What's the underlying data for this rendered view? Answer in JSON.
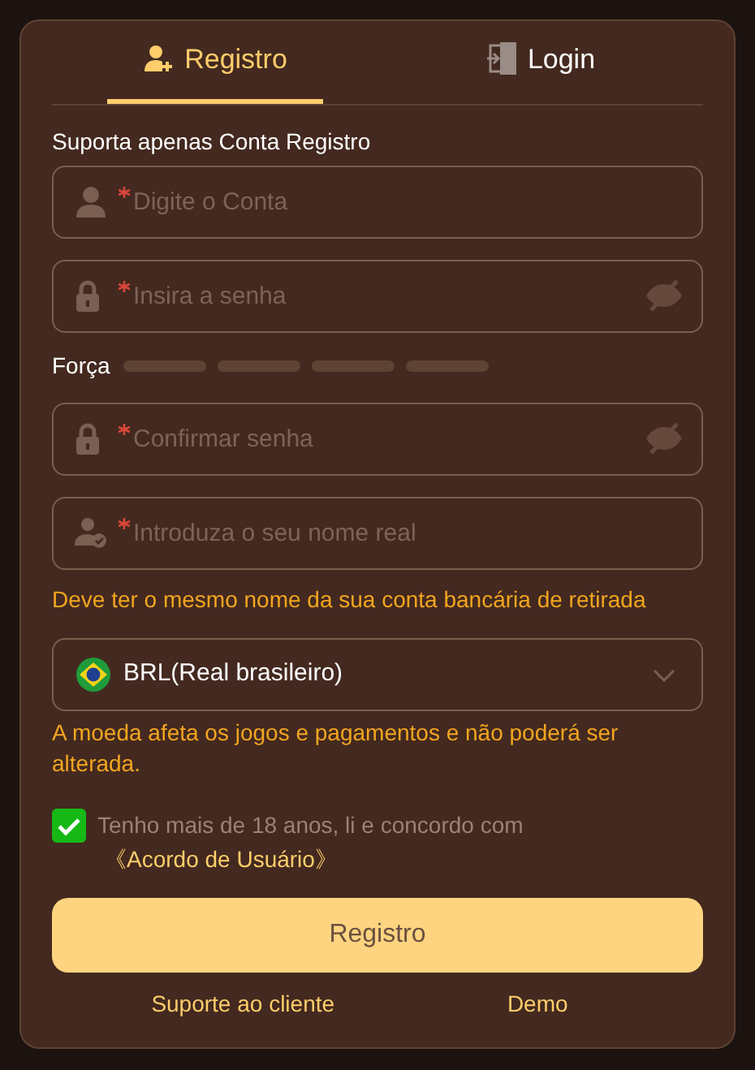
{
  "tabs": [
    {
      "label": "Registro",
      "selected": true
    },
    {
      "label": "Login",
      "selected": false
    }
  ],
  "notice": "Suporta apenas Conta Registro",
  "form": [
    {
      "kind": "account",
      "placeholder": "Digite o Conta"
    },
    {
      "kind": "password",
      "placeholder": "Insira a senha"
    },
    {
      "kind": "strength",
      "label": "Força"
    },
    {
      "kind": "password",
      "placeholder": "Confirmar senha"
    },
    {
      "kind": "name",
      "placeholder": "Introduza o seu nome real"
    },
    {
      "kind": "hint",
      "text": "Deve ter o mesmo nome da sua conta bancária de retirada"
    },
    {
      "kind": "select",
      "value": "BRL(Real brasileiro)"
    },
    {
      "kind": "hint",
      "text": "A moeda afeta os jogos e pagamentos e não poderá ser alterada."
    }
  ],
  "agreement": {
    "checked": true,
    "text": "Tenho mais de 18 anos, li e concordo com",
    "link": "《Acordo de Usuário》"
  },
  "submit": "Registro",
  "links": [
    "Suporte ao cliente",
    "Demo"
  ]
}
